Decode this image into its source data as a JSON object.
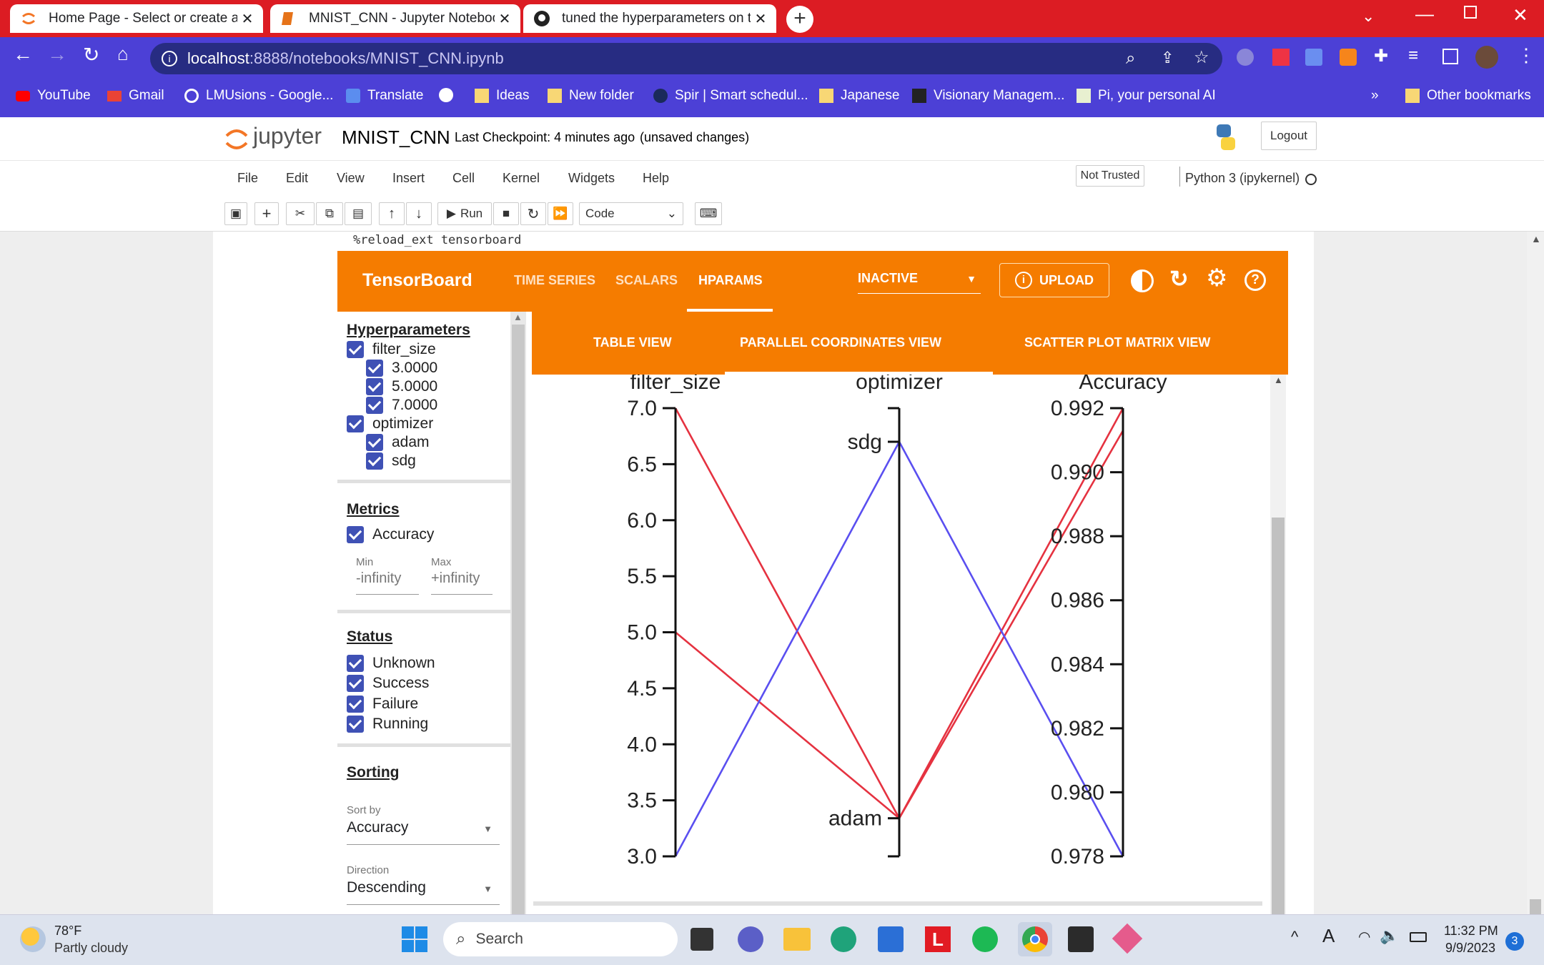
{
  "browser": {
    "tabs": [
      {
        "title": "Home Page - Select or create a n",
        "icon": "jupyter-icon"
      },
      {
        "title": "MNIST_CNN - Jupyter Notebook",
        "icon": "notebook-icon"
      },
      {
        "title": "tuned the hyperparameters on te",
        "icon": "github-icon"
      }
    ],
    "url_host": "localhost",
    "url_rest": ":8888/notebooks/MNIST_CNN.ipynb",
    "bookmarks": [
      "YouTube",
      "Gmail",
      "LMUsions - Google...",
      "Translate",
      "Ideas",
      "New folder",
      "Spir | Smart schedul...",
      "Japanese",
      "Visionary Managem...",
      "Pi, your personal AI"
    ],
    "other_bookmarks": "Other bookmarks",
    "overflow": "»"
  },
  "jupyter": {
    "logo": "jupyter",
    "notebook_name": "MNIST_CNN",
    "checkpoint": "Last Checkpoint: 4 minutes ago",
    "unsaved": "(unsaved changes)",
    "logout": "Logout",
    "menu": [
      "File",
      "Edit",
      "View",
      "Insert",
      "Cell",
      "Kernel",
      "Widgets",
      "Help"
    ],
    "trust": "Not Trusted",
    "kernel": "Python 3 (ipykernel)",
    "run_label": "Run",
    "cell_type": "Code",
    "code_line": "%reload_ext tensorboard"
  },
  "tensorboard": {
    "brand": "TensorBoard",
    "nav": [
      "TIME SERIES",
      "SCALARS",
      "HPARAMS"
    ],
    "active_nav": "HPARAMS",
    "run_select": "INACTIVE",
    "upload": "UPLOAD",
    "views": [
      "TABLE VIEW",
      "PARALLEL COORDINATES VIEW",
      "SCATTER PLOT MATRIX VIEW"
    ],
    "active_view": "PARALLEL COORDINATES VIEW",
    "sidebar": {
      "hparams_title": "Hyperparameters",
      "filter_size": "filter_size",
      "filter_values": [
        "3.0000",
        "5.0000",
        "7.0000"
      ],
      "optimizer": "optimizer",
      "optimizer_values": [
        "adam",
        "sdg"
      ],
      "metrics_title": "Metrics",
      "metric": "Accuracy",
      "min_label": "Min",
      "max_label": "Max",
      "min_value": "-infinity",
      "max_value": "+infinity",
      "status_title": "Status",
      "statuses": [
        "Unknown",
        "Success",
        "Failure",
        "Running"
      ],
      "sorting_title": "Sorting",
      "sort_by_label": "Sort by",
      "sort_by_value": "Accuracy",
      "direction_label": "Direction",
      "direction_value": "Descending"
    }
  },
  "chart_data": {
    "type": "parallel_coordinates",
    "axes": [
      {
        "name": "filter_size",
        "range": [
          3.0,
          7.0
        ],
        "ticks": [
          "3.0",
          "3.5",
          "4.0",
          "4.5",
          "5.0",
          "5.5",
          "6.0",
          "6.5",
          "7.0"
        ]
      },
      {
        "name": "optimizer",
        "categories": [
          "adam",
          "sdg"
        ]
      },
      {
        "name": "Accuracy",
        "range": [
          0.978,
          0.992
        ],
        "ticks": [
          "0.978",
          "0.980",
          "0.982",
          "0.984",
          "0.986",
          "0.988",
          "0.990",
          "0.992"
        ]
      }
    ],
    "series": [
      {
        "filter_size": 7.0,
        "optimizer": "adam",
        "Accuracy": 0.992,
        "color": "#e53240"
      },
      {
        "filter_size": 5.0,
        "optimizer": "adam",
        "Accuracy": 0.9913,
        "color": "#e53240"
      },
      {
        "filter_size": 3.0,
        "optimizer": "sdg",
        "Accuracy": 0.978,
        "color": "#5a4ff0"
      }
    ]
  },
  "taskbar": {
    "temperature": "78°F",
    "weather": "Partly cloudy",
    "search": "Search",
    "time": "11:32 PM",
    "date": "9/9/2023",
    "notif_count": "3"
  },
  "colors": {
    "tab_strip": "#dc1c23",
    "toolbar": "#4c40d6",
    "tensorboard": "#f57c00",
    "checkbox": "#3f51b5"
  }
}
